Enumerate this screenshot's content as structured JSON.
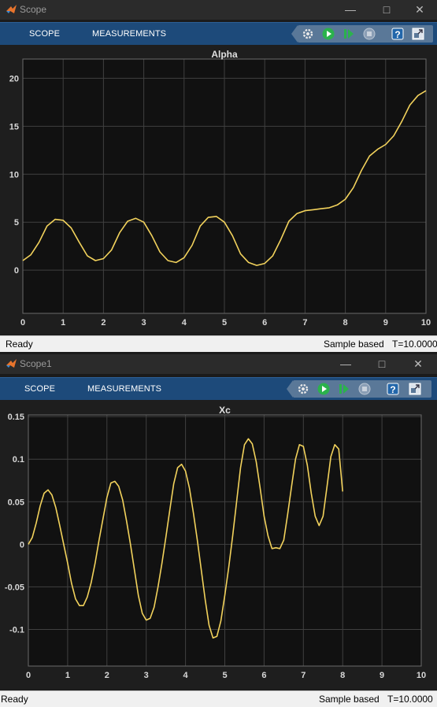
{
  "windows": [
    {
      "title": "Scope",
      "tabs": [
        "SCOPE",
        "MEASUREMENTS"
      ],
      "status": {
        "ready": "Ready",
        "mode": "Sample based",
        "time": "T=10.0000"
      }
    },
    {
      "title": "Scope1",
      "tabs": [
        "SCOPE",
        "MEASUREMENTS"
      ],
      "status": {
        "ready": "Ready",
        "mode": "Sample based",
        "time": "T=10.0000"
      }
    }
  ],
  "colors": {
    "trace": "#f2d25c",
    "axes_bg": "#111111",
    "grid": "#404040",
    "toolstrip": "#1d4a7a"
  },
  "icons": [
    "settings-icon",
    "run-icon",
    "step-forward-icon",
    "stop-icon",
    "help-icon",
    "undock-icon"
  ],
  "chart_data": [
    {
      "type": "line",
      "title": "Alpha",
      "xlabel": "",
      "ylabel": "",
      "xlim": [
        0,
        10
      ],
      "ylim": [
        -4.5,
        22
      ],
      "xticks": [
        "0",
        "1",
        "2",
        "3",
        "4",
        "5",
        "6",
        "7",
        "8",
        "9",
        "10"
      ],
      "yticks": [
        "0",
        "5",
        "10",
        "15",
        "20"
      ],
      "grid": true,
      "x": [
        0,
        0.2,
        0.4,
        0.6,
        0.8,
        1.0,
        1.2,
        1.4,
        1.6,
        1.8,
        2.0,
        2.2,
        2.4,
        2.6,
        2.8,
        3.0,
        3.2,
        3.4,
        3.6,
        3.8,
        4.0,
        4.2,
        4.4,
        4.6,
        4.8,
        5.0,
        5.2,
        5.4,
        5.6,
        5.8,
        6.0,
        6.2,
        6.4,
        6.6,
        6.8,
        7.0,
        7.2,
        7.4,
        7.6,
        7.8,
        8.0,
        8.2,
        8.4,
        8.6,
        8.8,
        9.0,
        9.2,
        9.4,
        9.6,
        9.8,
        10.0
      ],
      "y": [
        1.0,
        1.6,
        2.9,
        4.6,
        5.3,
        5.2,
        4.4,
        2.9,
        1.5,
        1.0,
        1.2,
        2.1,
        3.9,
        5.1,
        5.4,
        5.0,
        3.6,
        1.9,
        1.0,
        0.8,
        1.3,
        2.6,
        4.6,
        5.5,
        5.6,
        5.0,
        3.6,
        1.7,
        0.8,
        0.5,
        0.7,
        1.5,
        3.2,
        5.1,
        5.9,
        6.2,
        6.3,
        6.4,
        6.5,
        6.8,
        7.4,
        8.6,
        10.4,
        11.9,
        12.6,
        13.1,
        14.0,
        15.5,
        17.2,
        18.2,
        18.7
      ]
    },
    {
      "type": "line",
      "title": "Xc",
      "xlabel": "",
      "ylabel": "",
      "xlim": [
        0,
        10
      ],
      "ylim": [
        -0.143,
        0.152
      ],
      "xticks": [
        "0",
        "1",
        "2",
        "3",
        "4",
        "5",
        "6",
        "7",
        "8",
        "9",
        "10"
      ],
      "yticks": [
        "-0.1",
        "-0.05",
        "0",
        "0.05",
        "0.1",
        "0.15"
      ],
      "grid": true,
      "x": [
        0,
        0.1,
        0.2,
        0.3,
        0.4,
        0.5,
        0.6,
        0.7,
        0.8,
        0.9,
        1.0,
        1.1,
        1.2,
        1.3,
        1.4,
        1.5,
        1.6,
        1.7,
        1.8,
        1.9,
        2.0,
        2.1,
        2.2,
        2.3,
        2.4,
        2.5,
        2.6,
        2.7,
        2.8,
        2.9,
        3.0,
        3.1,
        3.2,
        3.3,
        3.4,
        3.5,
        3.6,
        3.7,
        3.8,
        3.9,
        4.0,
        4.1,
        4.2,
        4.3,
        4.4,
        4.5,
        4.6,
        4.7,
        4.8,
        4.9,
        5.0,
        5.1,
        5.2,
        5.3,
        5.4,
        5.5,
        5.6,
        5.7,
        5.8,
        5.9,
        6.0,
        6.1,
        6.2,
        6.3,
        6.4,
        6.5,
        6.6,
        6.7,
        6.8,
        6.9,
        7.0,
        7.1,
        7.2,
        7.3,
        7.4,
        7.5,
        7.6,
        7.7,
        7.8,
        7.9,
        8.0,
        8.1,
        8.2,
        8.3,
        8.4,
        8.5,
        8.6,
        8.7,
        8.8,
        8.9,
        9.0,
        9.1,
        9.2,
        9.3,
        9.4,
        9.5,
        9.6,
        9.7,
        9.8,
        9.9,
        10.0
      ],
      "y": [
        0,
        0.008,
        0.025,
        0.045,
        0.06,
        0.064,
        0.058,
        0.043,
        0.022,
        0,
        -0.022,
        -0.046,
        -0.064,
        -0.072,
        -0.072,
        -0.062,
        -0.045,
        -0.022,
        0.005,
        0.03,
        0.055,
        0.072,
        0.074,
        0.068,
        0.052,
        0.027,
        0,
        -0.03,
        -0.06,
        -0.081,
        -0.089,
        -0.087,
        -0.074,
        -0.05,
        -0.022,
        0.008,
        0.04,
        0.071,
        0.09,
        0.094,
        0.086,
        0.066,
        0.037,
        0.005,
        -0.03,
        -0.065,
        -0.095,
        -0.11,
        -0.108,
        -0.09,
        -0.06,
        -0.027,
        0.01,
        0.05,
        0.09,
        0.117,
        0.124,
        0.118,
        0.097,
        0.066,
        0.033,
        0.01,
        -0.005,
        -0.004,
        -0.005,
        0.005,
        0.035,
        0.068,
        0.1,
        0.117,
        0.115,
        0.093,
        0.06,
        0.033,
        0.022,
        0.033,
        0.067,
        0.103,
        0.117,
        0.112,
        0.062
      ]
    }
  ]
}
